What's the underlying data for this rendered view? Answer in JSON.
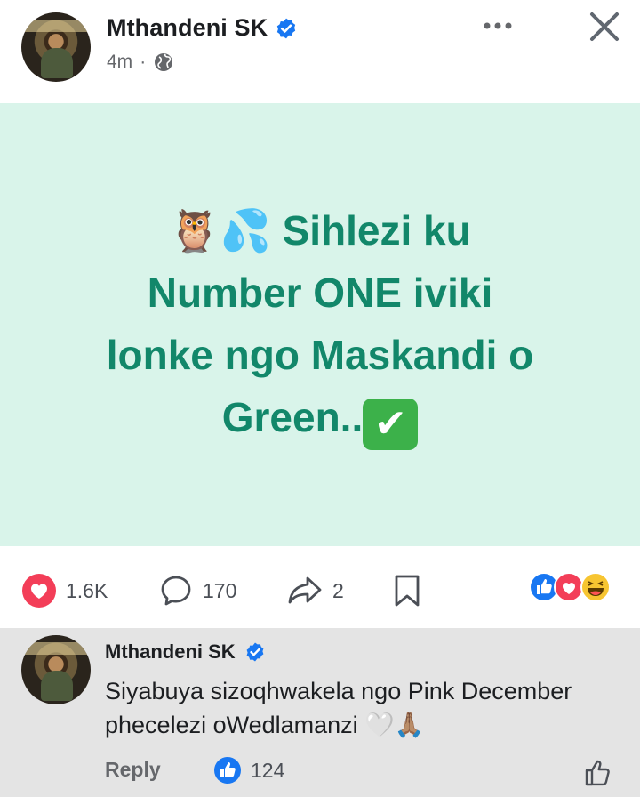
{
  "post": {
    "author": "Mthandeni SK",
    "time": "4m",
    "separator": "·",
    "text_line1": " Sihlezi ku",
    "text_line2": "Number ONE iviki",
    "text_line3": "lonke ngo Maskandi o",
    "text_line4": "Green..",
    "emoji_owl": "🦉",
    "emoji_drops": "💦",
    "emoji_check": "✔",
    "background_color": "#d9f4ea",
    "text_color": "#12876a"
  },
  "actions": {
    "reactions_count": "1.6K",
    "comments_count": "170",
    "shares_count": "2",
    "reaction_icons": [
      "like-icon",
      "love-icon",
      "haha-icon"
    ]
  },
  "comment": {
    "author": "Mthandeni SK",
    "text": "Siyabuya sizoqhwakela ngo Pink December phecelezi oWedlamanzi 🤍🙏🏽",
    "reply_label": "Reply",
    "likes_count": "124"
  },
  "colors": {
    "facebook_blue": "#1877f2",
    "love_red": "#f33e58",
    "accent_green": "#12876a"
  }
}
